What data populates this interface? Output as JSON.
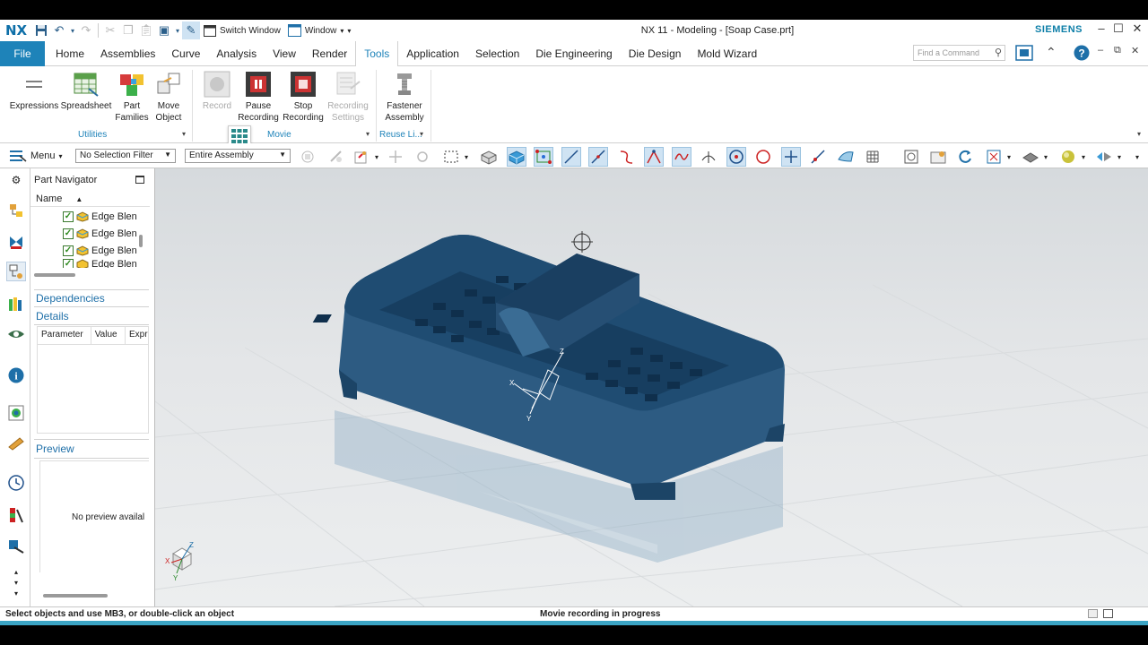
{
  "app": {
    "logo": "NX",
    "window_title": "NX 11 - Modeling - [Soap Case.prt]",
    "brand": "SIEMENS",
    "brand_color": "#0e7fa8",
    "accent_color": "#1e83b9"
  },
  "quick_access": {
    "switch_window": "Switch Window",
    "window": "Window"
  },
  "tabs": {
    "file": "File",
    "items": [
      "Home",
      "Assemblies",
      "Curve",
      "Analysis",
      "View",
      "Render",
      "Tools",
      "Application",
      "Selection",
      "Die Engineering",
      "Die Design",
      "Mold Wizard"
    ],
    "active": "Tools"
  },
  "command_finder": {
    "placeholder": "Find a Command"
  },
  "ribbon": {
    "expressions": "Expressions",
    "spreadsheet": "Spreadsheet",
    "part_families_1": "Part",
    "part_families_2": "Families",
    "move_object_1": "Move",
    "move_object_2": "Object",
    "record": "Record",
    "pause_recording_1": "Pause",
    "pause_recording_2": "Recording",
    "stop_recording_1": "Stop",
    "stop_recording_2": "Recording",
    "recording_settings_1": "Recording",
    "recording_settings_2": "Settings",
    "fastener_assembly_1": "Fastener",
    "fastener_assembly_2": "Assembly",
    "group_utilities": "Utilities",
    "group_movie": "Movie",
    "group_reuse": "Reuse Li..."
  },
  "toolbar": {
    "menu": "Menu",
    "selection_filter": "No Selection Filter",
    "scope": "Entire Assembly"
  },
  "navigator": {
    "title": "Part Navigator",
    "column_name": "Name",
    "rows": [
      "Edge Blen",
      "Edge Blen",
      "Edge Blen",
      "Edge Blen"
    ],
    "dependencies": "Dependencies",
    "details": "Details",
    "details_columns": [
      "Parameter",
      "Value",
      "Expr"
    ],
    "preview": "Preview",
    "preview_empty": "No preview availal"
  },
  "axes": {
    "x": "X",
    "y": "Y",
    "z": "Z"
  },
  "status": {
    "prompt": "Select objects and use MB3, or double-click an object",
    "message": "Movie recording in progress"
  }
}
